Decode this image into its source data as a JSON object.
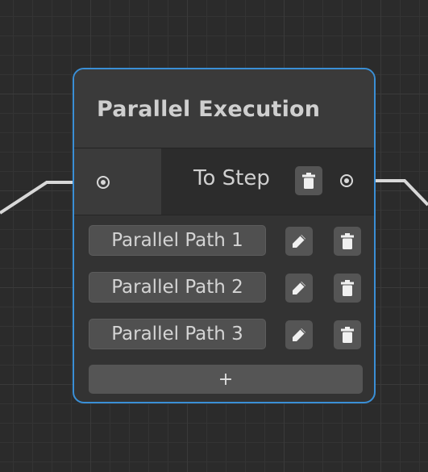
{
  "node": {
    "title": "Parallel Execution",
    "output_label": "To Step",
    "accent_color": "#3a8fd6"
  },
  "paths": [
    {
      "label": "Parallel Path 1"
    },
    {
      "label": "Parallel Path 2"
    },
    {
      "label": "Parallel Path 3"
    }
  ],
  "add_button_label": "+",
  "icons": {
    "input_port": "port-icon",
    "output_port": "port-icon",
    "edit": "pencil-icon",
    "delete": "trash-icon"
  }
}
